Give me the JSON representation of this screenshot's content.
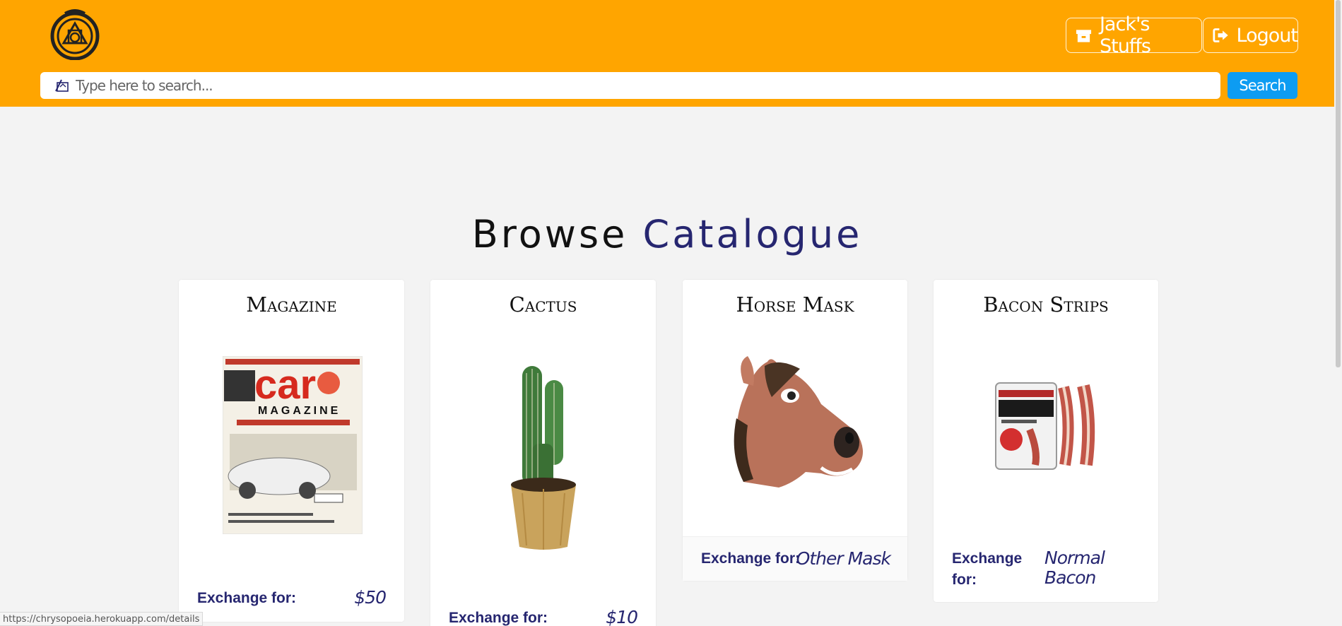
{
  "header": {
    "stuffs_label": "Jack's Stuffs",
    "logout_label": "Logout",
    "search_placeholder": "Type here to search...",
    "search_button": "Search",
    "colors": {
      "bar": "#ffa500",
      "search_button": "#0d9cf2"
    }
  },
  "main": {
    "title_part1": "Browse",
    "title_part2": "Catalogue",
    "exchange_label": "Exchange for:",
    "items": [
      {
        "name": "Magazine",
        "exchange": "$50",
        "image": "car-magazine-image"
      },
      {
        "name": "Cactus",
        "exchange": "$10",
        "image": "cactus-image"
      },
      {
        "name": "Horse Mask",
        "exchange": "Other Mask",
        "image": "horse-mask-image"
      },
      {
        "name": "Bacon Strips",
        "exchange": "Normal Bacon",
        "image": "bacon-bandages-image"
      }
    ]
  },
  "status_bar": {
    "url": "https://chrysopoeia.herokuapp.com/details"
  },
  "colors": {
    "accent": "#262670",
    "background": "#f3f3f3"
  }
}
